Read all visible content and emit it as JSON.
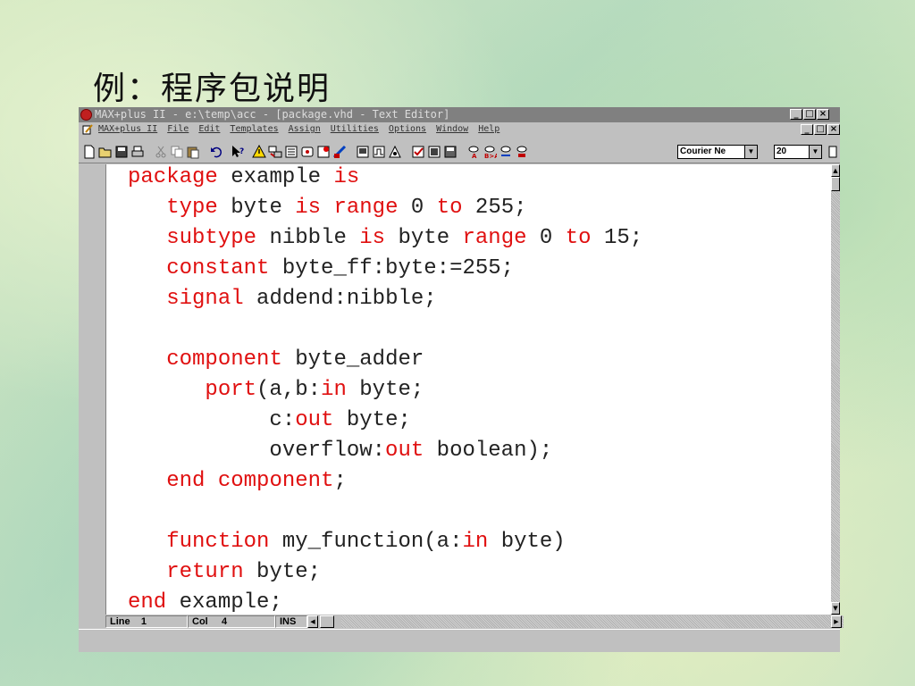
{
  "slide": {
    "title": "例：程序包说明"
  },
  "window": {
    "title": "MAX+plus II - e:\\temp\\acc - [package.vhd - Text Editor]",
    "buttons": {
      "minimize": "_",
      "restore": "□",
      "close": "×"
    }
  },
  "menu": {
    "items": [
      "MAX+plus II",
      "File",
      "Edit",
      "Templates",
      "Assign",
      "Utilities",
      "Options",
      "Window",
      "Help"
    ]
  },
  "toolbar": {
    "font_name": "Courier Ne",
    "font_size": "20"
  },
  "code": {
    "lines": [
      [
        {
          "t": "package",
          "k": true
        },
        {
          "t": " example "
        },
        {
          "t": "is",
          "k": true
        }
      ],
      [
        {
          "t": "   "
        },
        {
          "t": "type",
          "k": true
        },
        {
          "t": " byte "
        },
        {
          "t": "is",
          "k": true
        },
        {
          "t": " "
        },
        {
          "t": "range",
          "k": true
        },
        {
          "t": " 0 "
        },
        {
          "t": "to",
          "k": true
        },
        {
          "t": " 255;"
        }
      ],
      [
        {
          "t": "   "
        },
        {
          "t": "subtype",
          "k": true
        },
        {
          "t": " nibble "
        },
        {
          "t": "is",
          "k": true
        },
        {
          "t": " byte "
        },
        {
          "t": "range",
          "k": true
        },
        {
          "t": " 0 "
        },
        {
          "t": "to",
          "k": true
        },
        {
          "t": " 15;"
        }
      ],
      [
        {
          "t": "   "
        },
        {
          "t": "constant",
          "k": true
        },
        {
          "t": " byte_ff:byte:=255;"
        }
      ],
      [
        {
          "t": "   "
        },
        {
          "t": "signal",
          "k": true
        },
        {
          "t": " addend:nibble;"
        }
      ],
      [
        {
          "t": ""
        }
      ],
      [
        {
          "t": "   "
        },
        {
          "t": "component",
          "k": true
        },
        {
          "t": " byte_adder"
        }
      ],
      [
        {
          "t": "      "
        },
        {
          "t": "port",
          "k": true
        },
        {
          "t": "(a,b:"
        },
        {
          "t": "in",
          "k": true
        },
        {
          "t": " byte;"
        }
      ],
      [
        {
          "t": "           c:"
        },
        {
          "t": "out",
          "k": true
        },
        {
          "t": " byte;"
        }
      ],
      [
        {
          "t": "           overflow:"
        },
        {
          "t": "out",
          "k": true
        },
        {
          "t": " boolean);"
        }
      ],
      [
        {
          "t": "   "
        },
        {
          "t": "end",
          "k": true
        },
        {
          "t": " "
        },
        {
          "t": "component",
          "k": true
        },
        {
          "t": ";"
        }
      ],
      [
        {
          "t": ""
        }
      ],
      [
        {
          "t": "   "
        },
        {
          "t": "function",
          "k": true
        },
        {
          "t": " my_function(a:"
        },
        {
          "t": "in",
          "k": true
        },
        {
          "t": " byte)"
        }
      ],
      [
        {
          "t": "   "
        },
        {
          "t": "return",
          "k": true
        },
        {
          "t": " byte;"
        }
      ],
      [
        {
          "t": "end",
          "k": true
        },
        {
          "t": " example;"
        }
      ]
    ]
  },
  "status": {
    "line_label": "Line",
    "line_value": "1",
    "col_label": "Col",
    "col_value": "4",
    "mode": "INS"
  },
  "colors": {
    "keyword": "#e01010",
    "text": "#222222",
    "chrome": "#c0c0c0",
    "titlebar": "#808080"
  }
}
